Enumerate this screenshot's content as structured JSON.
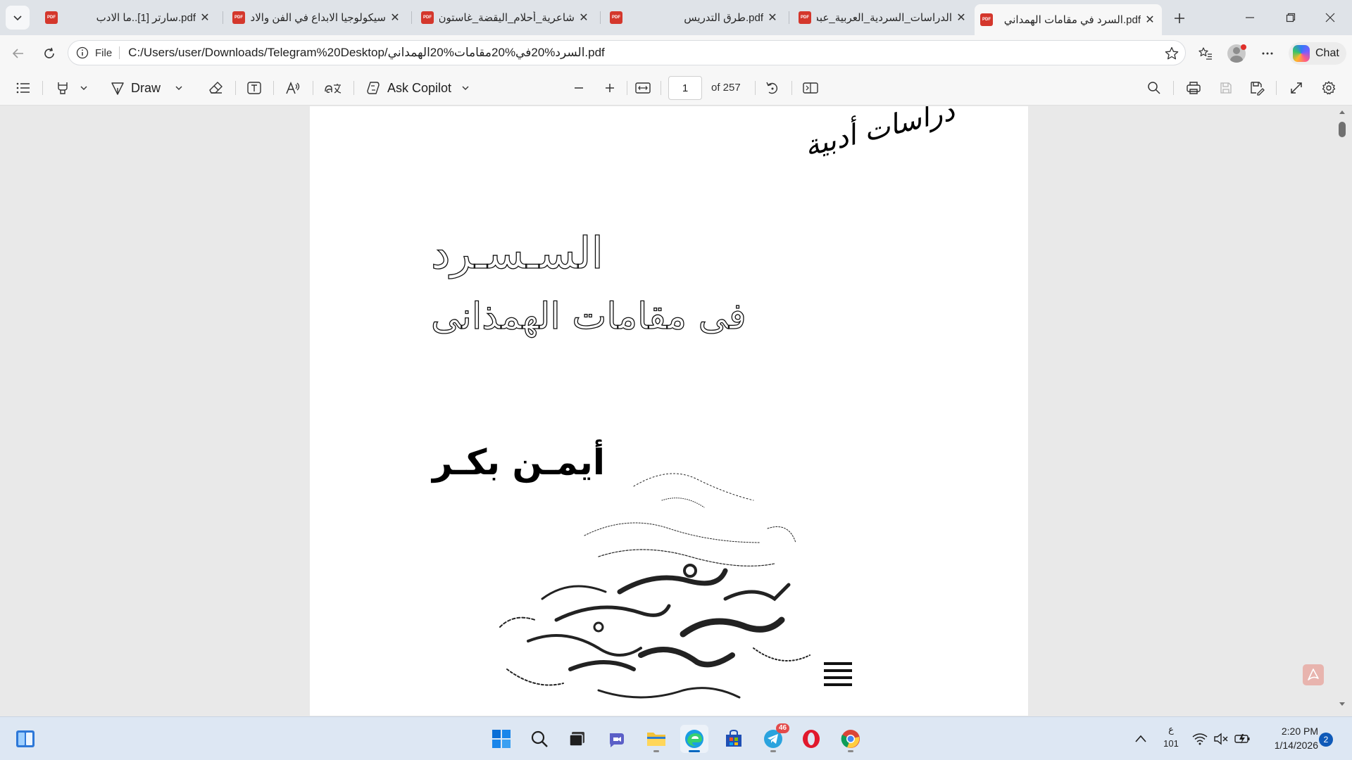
{
  "tabs": [
    {
      "title": "pdf.سارتر [1]..ما الادب",
      "close": "✕"
    },
    {
      "title": "سيكولوجيا الابداع في الفن والادب",
      "close": "✕"
    },
    {
      "title": "شاعرية_أحلام_اليقضة_غاستون_باشلار",
      "close": "✕"
    },
    {
      "title": "pdf.طرق التدريس",
      "close": "✕"
    },
    {
      "title": "الدراسات_السردية_العربية_عبد_الله_ابراهيم",
      "close": "✕"
    },
    {
      "title": "pdf.السرد في مقامات الهمداني",
      "close": "✕"
    }
  ],
  "tab_pdf_label": "PDF",
  "address": {
    "scheme": "File",
    "url": "C:/Users/user/Downloads/Telegram%20Desktop/السرد%20في%20مقامات%20الهمداني.pdf"
  },
  "chat_label": "Chat",
  "pdf_toolbar": {
    "draw_label": "Draw",
    "copilot_label": "Ask Copilot",
    "page_value": "1",
    "page_count": "of 257"
  },
  "document": {
    "series": "دراسات أدبية",
    "title_line1": "السـسـرد",
    "title_line2": "فى مقامات الهمذانى",
    "author": "أيمـن بكـر"
  },
  "taskbar": {
    "lang_top": "ع",
    "lang_bottom": "101",
    "time": "2:20 PM",
    "date": "1/14/2026",
    "notif_count": "2",
    "telegram_badge": "46"
  }
}
